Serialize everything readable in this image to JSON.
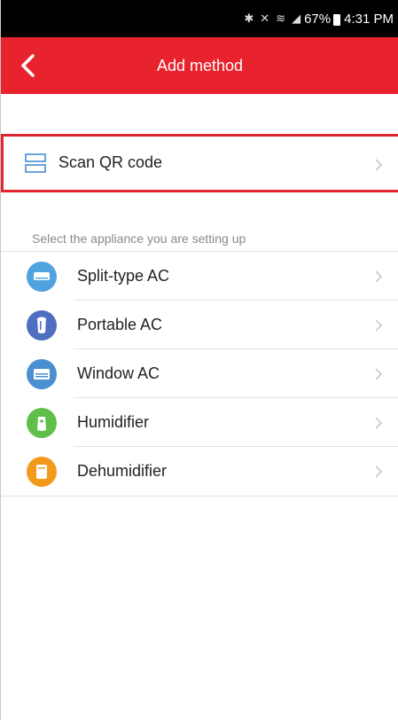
{
  "status_bar": {
    "battery_percent": "67%",
    "time": "4:31 PM"
  },
  "header": {
    "title": "Add method"
  },
  "scan": {
    "label": "Scan QR code"
  },
  "appliances": {
    "section_header": "Select the appliance you are setting up",
    "items": [
      {
        "label": "Split-type AC",
        "icon": "split-ac-icon",
        "color": "#4fa3df"
      },
      {
        "label": "Portable AC",
        "icon": "portable-ac-icon",
        "color": "#4e6fc0"
      },
      {
        "label": "Window AC",
        "icon": "window-ac-icon",
        "color": "#4a8fd0"
      },
      {
        "label": "Humidifier",
        "icon": "humidifier-icon",
        "color": "#5fbf4a"
      },
      {
        "label": "Dehumidifier",
        "icon": "dehumidifier-icon",
        "color": "#f39a1c"
      }
    ]
  },
  "colors": {
    "accent": "#e8232d",
    "highlight_border": "#e02530"
  }
}
